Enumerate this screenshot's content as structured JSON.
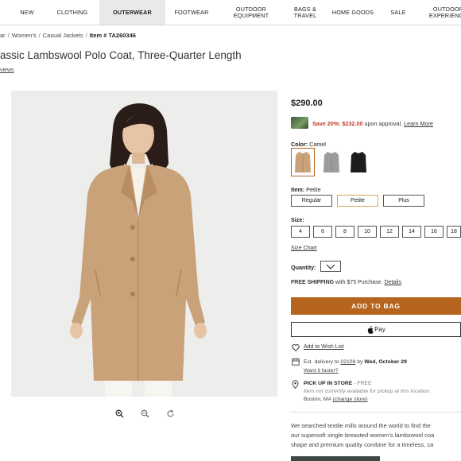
{
  "nav": {
    "items": [
      {
        "label": "NEW"
      },
      {
        "label": "CLOTHING"
      },
      {
        "label": "OUTERWEAR"
      },
      {
        "label": "FOOTWEAR"
      },
      {
        "label": "OUTDOOR\nEQUIPMENT"
      },
      {
        "label": "BAGS &\nTRAVEL"
      },
      {
        "label": "HOME GOODS"
      },
      {
        "label": "SALE"
      },
      {
        "label": "OUTDOOR\nEXPERIENCE"
      }
    ],
    "active": "OUTERWEAR"
  },
  "breadcrumb": {
    "items": [
      "ar",
      "Women's",
      "Casual Jackets"
    ],
    "item_number": "Item # TA260346"
  },
  "product": {
    "title": "assic Lambswool Polo Coat, Three-Quarter Length",
    "reviews_link": "views",
    "price": "$290.00",
    "promo": {
      "save": "Save 20%: $232.00",
      "text": " upon approval. ",
      "learn_more": "Learn More"
    },
    "color": {
      "label": "Color:",
      "value": " Camel",
      "swatches": [
        "camel",
        "gray",
        "black"
      ]
    },
    "item": {
      "label": "Item:",
      "value": " Petite",
      "options": [
        "Regular",
        "Petite",
        "Plus"
      ],
      "selected": "Petite"
    },
    "size": {
      "label": "Size:",
      "options": [
        "4",
        "6",
        "8",
        "10",
        "12",
        "14",
        "16",
        "18"
      ]
    },
    "size_chart": "Size Chart",
    "quantity_label": "Quantity:",
    "shipping": {
      "bold": "FREE SHIPPING",
      "text": " with $75 Purchase. ",
      "details": "Details"
    },
    "add_to_bag": "ADD TO BAG",
    "apple_pay": "Pay",
    "wish_list": "Add to Wish List",
    "delivery": {
      "prefix": "Est. delivery to ",
      "zip": "02108",
      "by": " by ",
      "date": "Wed, October 29",
      "faster": "Want it faster?"
    },
    "pickup": {
      "title": "PICK UP IN STORE",
      "free": " - FREE",
      "note": "Item not currently available for pickup at this location.",
      "location": "Boston, MA ",
      "change": "(change store)"
    },
    "description": [
      "We searched textile mills around the world to find the",
      "our supersoft single-breasted women's lambswool coa",
      "shape and premium quality combine for a timeless, ca"
    ]
  },
  "colors": {
    "accent": "#b5651d",
    "promo_red": "#c0392b",
    "camel": "#c9a27a",
    "gray": "#9c9c9c",
    "black": "#1c1c1c"
  },
  "icons": [
    "apple-icon",
    "zoom-in-icon",
    "zoom-out-icon",
    "rotate-icon",
    "heart-icon",
    "calendar-icon",
    "location-pin-icon",
    "chevron-down-icon",
    "card-icon"
  ]
}
